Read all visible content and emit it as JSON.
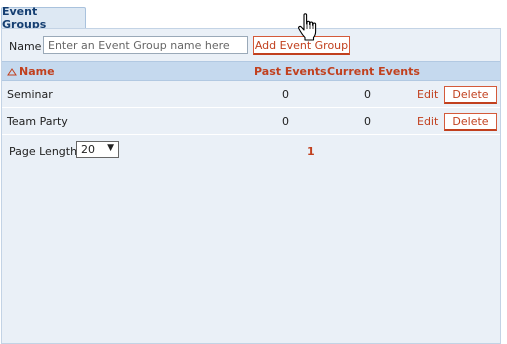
{
  "tab": {
    "label": "Event Groups"
  },
  "form": {
    "name_label": "Name",
    "name_placeholder": "Enter an Event Group name here",
    "name_value": "",
    "add_button": "Add Event Group"
  },
  "table": {
    "columns": {
      "name": "Name",
      "past": "Past Events",
      "current": "Current Events"
    },
    "sort": {
      "column": "name",
      "direction": "ascending"
    },
    "rows": [
      {
        "name": "Seminar",
        "past": "0",
        "current": "0",
        "edit": "Edit",
        "delete": "Delete"
      },
      {
        "name": "Team Party",
        "past": "0",
        "current": "0",
        "edit": "Edit",
        "delete": "Delete"
      }
    ]
  },
  "pagination": {
    "length_label": "Page Length",
    "length_value": "20",
    "current_page": "1"
  },
  "colors": {
    "accent": "#c1401e",
    "header_bg": "#c5d9ee",
    "panel_bg": "#eaf0f7",
    "tab_text": "#143e71"
  },
  "icons": {
    "sort": "sort-asc-icon",
    "dropdown": "dropdown-arrow-icon",
    "cursor": "hand-pointer-icon"
  }
}
